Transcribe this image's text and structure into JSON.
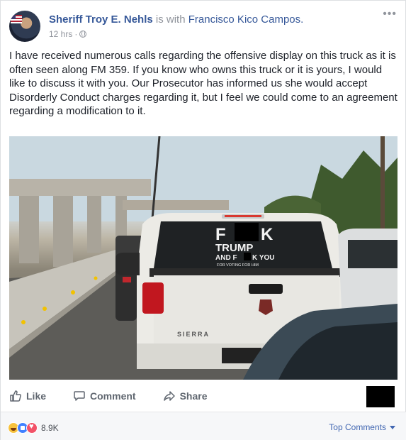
{
  "post": {
    "author": "Sheriff Troy E. Nehls",
    "with_text": "is with",
    "tagged": "Francisco Kico Campos.",
    "time": "12 hrs",
    "separator": "·",
    "privacy_icon": "globe-icon",
    "menu_icon": "more-icon",
    "menu_glyph": "•••",
    "text": "I have received numerous calls regarding the offensive display on this truck as it is often seen along FM 359. If you know who owns this truck or it is yours, I would like to discuss it with you. Our Prosecutor has informed us she would accept Disorderly Conduct charges regarding it, but I feel we could come to an agreement regarding a modification to it."
  },
  "photo": {
    "window_text": {
      "line1_left": "F",
      "line1_right": "K",
      "line2": "TRUMP",
      "line3_left": "AND F",
      "line3_right": "K YOU",
      "line4": "FOR VOTING FOR HIM"
    },
    "tailgate_badge": "SIERRA"
  },
  "actions": {
    "like": "Like",
    "comment": "Comment",
    "share": "Share",
    "like_icon": "thumbs-up-icon",
    "comment_icon": "comment-bubble-icon",
    "share_icon": "share-arrow-icon"
  },
  "footer": {
    "reaction_icons": [
      "haha-icon",
      "like-icon",
      "love-icon"
    ],
    "reaction_count": "8.9K",
    "top_comments": "Top Comments"
  },
  "colors": {
    "link": "#365899",
    "meta": "#90949c",
    "action": "#606770",
    "top_comments": "#4267b2"
  }
}
